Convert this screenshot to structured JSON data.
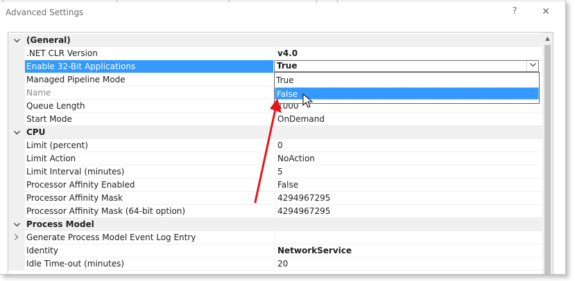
{
  "window": {
    "title": "Advanced Settings",
    "help_label": "?",
    "close_label": "✕"
  },
  "icons": {
    "expanded": "chevron-down-icon",
    "collapsed": "chevron-right-icon",
    "dropdown": "chevron-down-icon"
  },
  "colors": {
    "selection": "#3399ff",
    "category_bg": "#f0f0f0",
    "annotation_arrow": "#e8141c"
  },
  "grid": {
    "rows": [
      {
        "type": "category",
        "name": "(General)",
        "expander": "expanded"
      },
      {
        "type": "property",
        "name": ".NET CLR Version",
        "value": "v4.0",
        "bold": true
      },
      {
        "type": "property",
        "name": "Enable 32-Bit Applications",
        "value": "",
        "selected": true
      },
      {
        "type": "property",
        "name": "Managed Pipeline Mode",
        "value": ""
      },
      {
        "type": "property",
        "name": "Name",
        "value": "",
        "disabled": true
      },
      {
        "type": "property",
        "name": "Queue Length",
        "value": "1000"
      },
      {
        "type": "property",
        "name": "Start Mode",
        "value": "OnDemand"
      },
      {
        "type": "category",
        "name": "CPU",
        "expander": "expanded"
      },
      {
        "type": "property",
        "name": "Limit (percent)",
        "value": "0"
      },
      {
        "type": "property",
        "name": "Limit Action",
        "value": "NoAction"
      },
      {
        "type": "property",
        "name": "Limit Interval (minutes)",
        "value": "5"
      },
      {
        "type": "property",
        "name": "Processor Affinity Enabled",
        "value": "False"
      },
      {
        "type": "property",
        "name": "Processor Affinity Mask",
        "value": "4294967295"
      },
      {
        "type": "property",
        "name": "Processor Affinity Mask (64-bit option)",
        "value": "4294967295"
      },
      {
        "type": "category",
        "name": "Process Model",
        "expander": "expanded"
      },
      {
        "type": "property",
        "name": "Generate Process Model Event Log Entry",
        "value": "",
        "expander": "collapsed"
      },
      {
        "type": "property",
        "name": "Identity",
        "value": "NetworkService",
        "bold": true
      },
      {
        "type": "property",
        "name": "Idle Time-out (minutes)",
        "value": "20"
      }
    ]
  },
  "combo": {
    "value": "True",
    "options": [
      "True",
      "False"
    ],
    "highlighted_index": 1
  }
}
